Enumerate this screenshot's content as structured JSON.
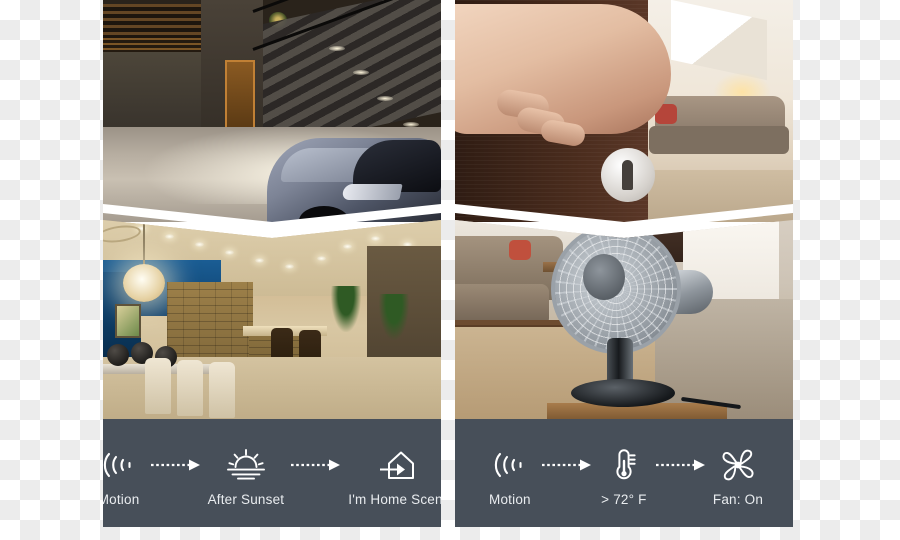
{
  "meta": {
    "layout": "two smart-home automation panels, each with two stacked photos above a dark caption bar",
    "caption_bar_color": "#474f59",
    "caption_text_color": "#e9ecef",
    "divider_color": "#ffffff",
    "background": "transparency-checkerboard"
  },
  "panels": [
    {
      "id": "lighting-automation",
      "photos": [
        {
          "name": "night-driveway-photo",
          "alt": "Modern home exterior at night with illuminated stairs, garage and a car in the driveway"
        },
        {
          "name": "open-living-room-photo",
          "alt": "Warmly lit open-plan dining and kitchen area with stone walls and recessed ceiling lights"
        }
      ],
      "flow": [
        {
          "icon": "motion-sensor-icon",
          "label": "Motion"
        },
        {
          "icon": "sunset-icon",
          "label": "After Sunset"
        },
        {
          "icon": "home-scene-icon",
          "label": "I'm Home Scene"
        }
      ]
    },
    {
      "id": "climate-automation",
      "photos": [
        {
          "name": "door-handle-photo",
          "alt": "Hand pressing a door handle on a dark wood door with a keyhole escutcheon, living room beyond"
        },
        {
          "name": "desk-fan-photo",
          "alt": "Chrome oscillating desk fan on a table in a living room with sofa and rug"
        }
      ],
      "flow": [
        {
          "icon": "motion-sensor-icon",
          "label": "Motion"
        },
        {
          "icon": "thermometer-icon",
          "label": "> 72° F"
        },
        {
          "icon": "fan-icon",
          "label": "Fan: On"
        }
      ]
    }
  ]
}
